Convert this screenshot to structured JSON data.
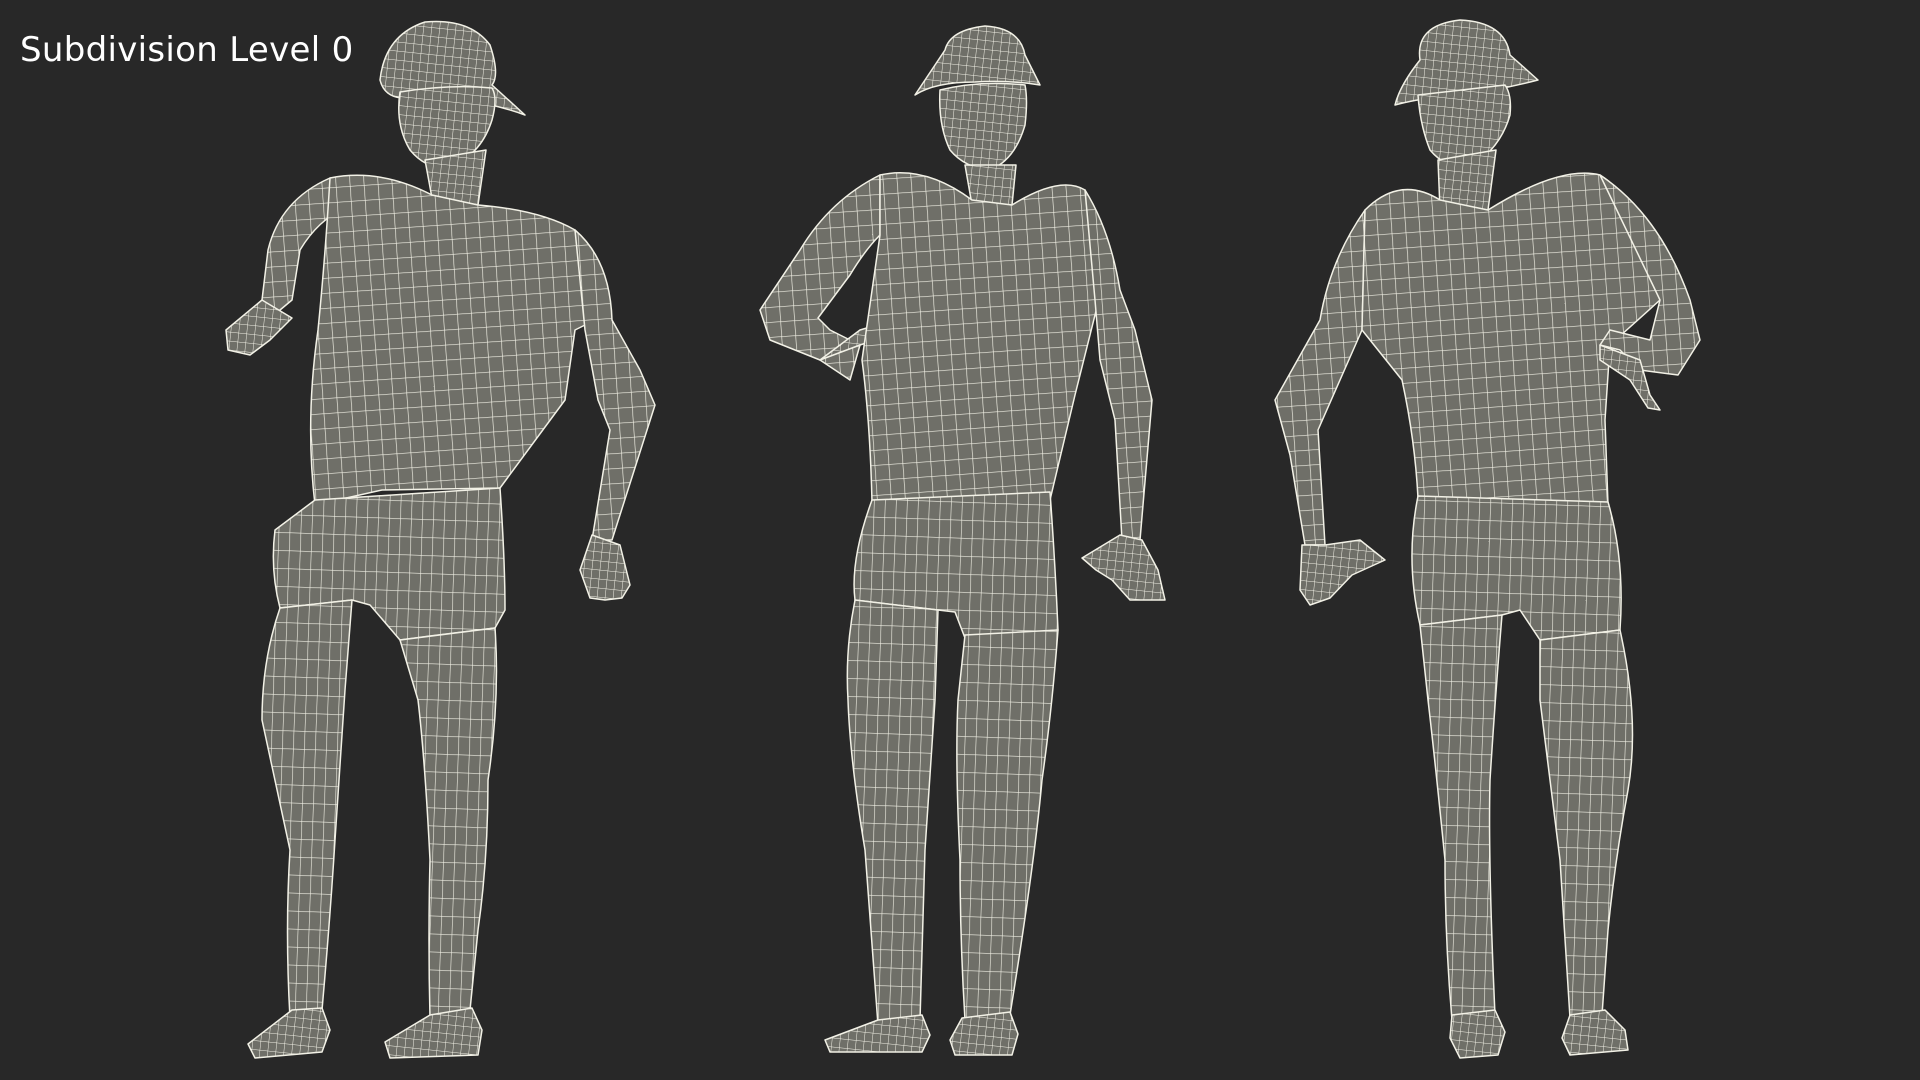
{
  "title": "Subdivision Level 0",
  "colors": {
    "background": "#282828",
    "mesh_fill": "#6f6f68",
    "mesh_wire": "#f2f1e6",
    "label": "#ffffff"
  },
  "figures": [
    {
      "name": "figure-three-quarter-view"
    },
    {
      "name": "figure-front-view"
    },
    {
      "name": "figure-back-view"
    }
  ]
}
